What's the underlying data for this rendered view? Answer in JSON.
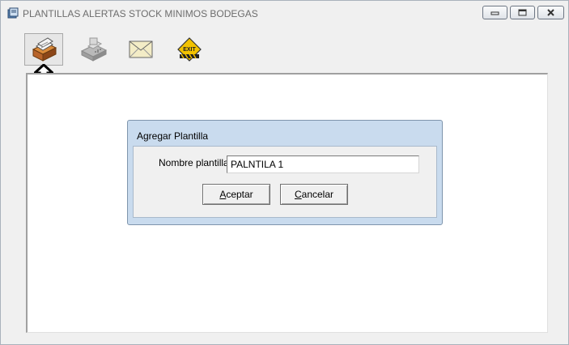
{
  "window": {
    "title": "PLANTILLAS ALERTAS STOCK MINIMOS BODEGAS"
  },
  "toolbar": {
    "buttons": [
      {
        "icon": "file-cabinet-icon",
        "active": true
      },
      {
        "icon": "fax-machine-icon",
        "active": false
      },
      {
        "icon": "envelope-icon",
        "active": false
      },
      {
        "icon": "exit-sign-icon",
        "active": false
      }
    ]
  },
  "dialog": {
    "title": "Agregar Plantilla",
    "field_label": "Nombre plantilla",
    "field_value": "PALNTILA 1",
    "ok_accel": "A",
    "ok_rest": "ceptar",
    "cancel_accel": "C",
    "cancel_rest": "ancelar"
  },
  "colors": {
    "dialog_frame": "#c9dbee",
    "exit_sign": "#f2c200",
    "window_bg": "#f0f0f0"
  }
}
